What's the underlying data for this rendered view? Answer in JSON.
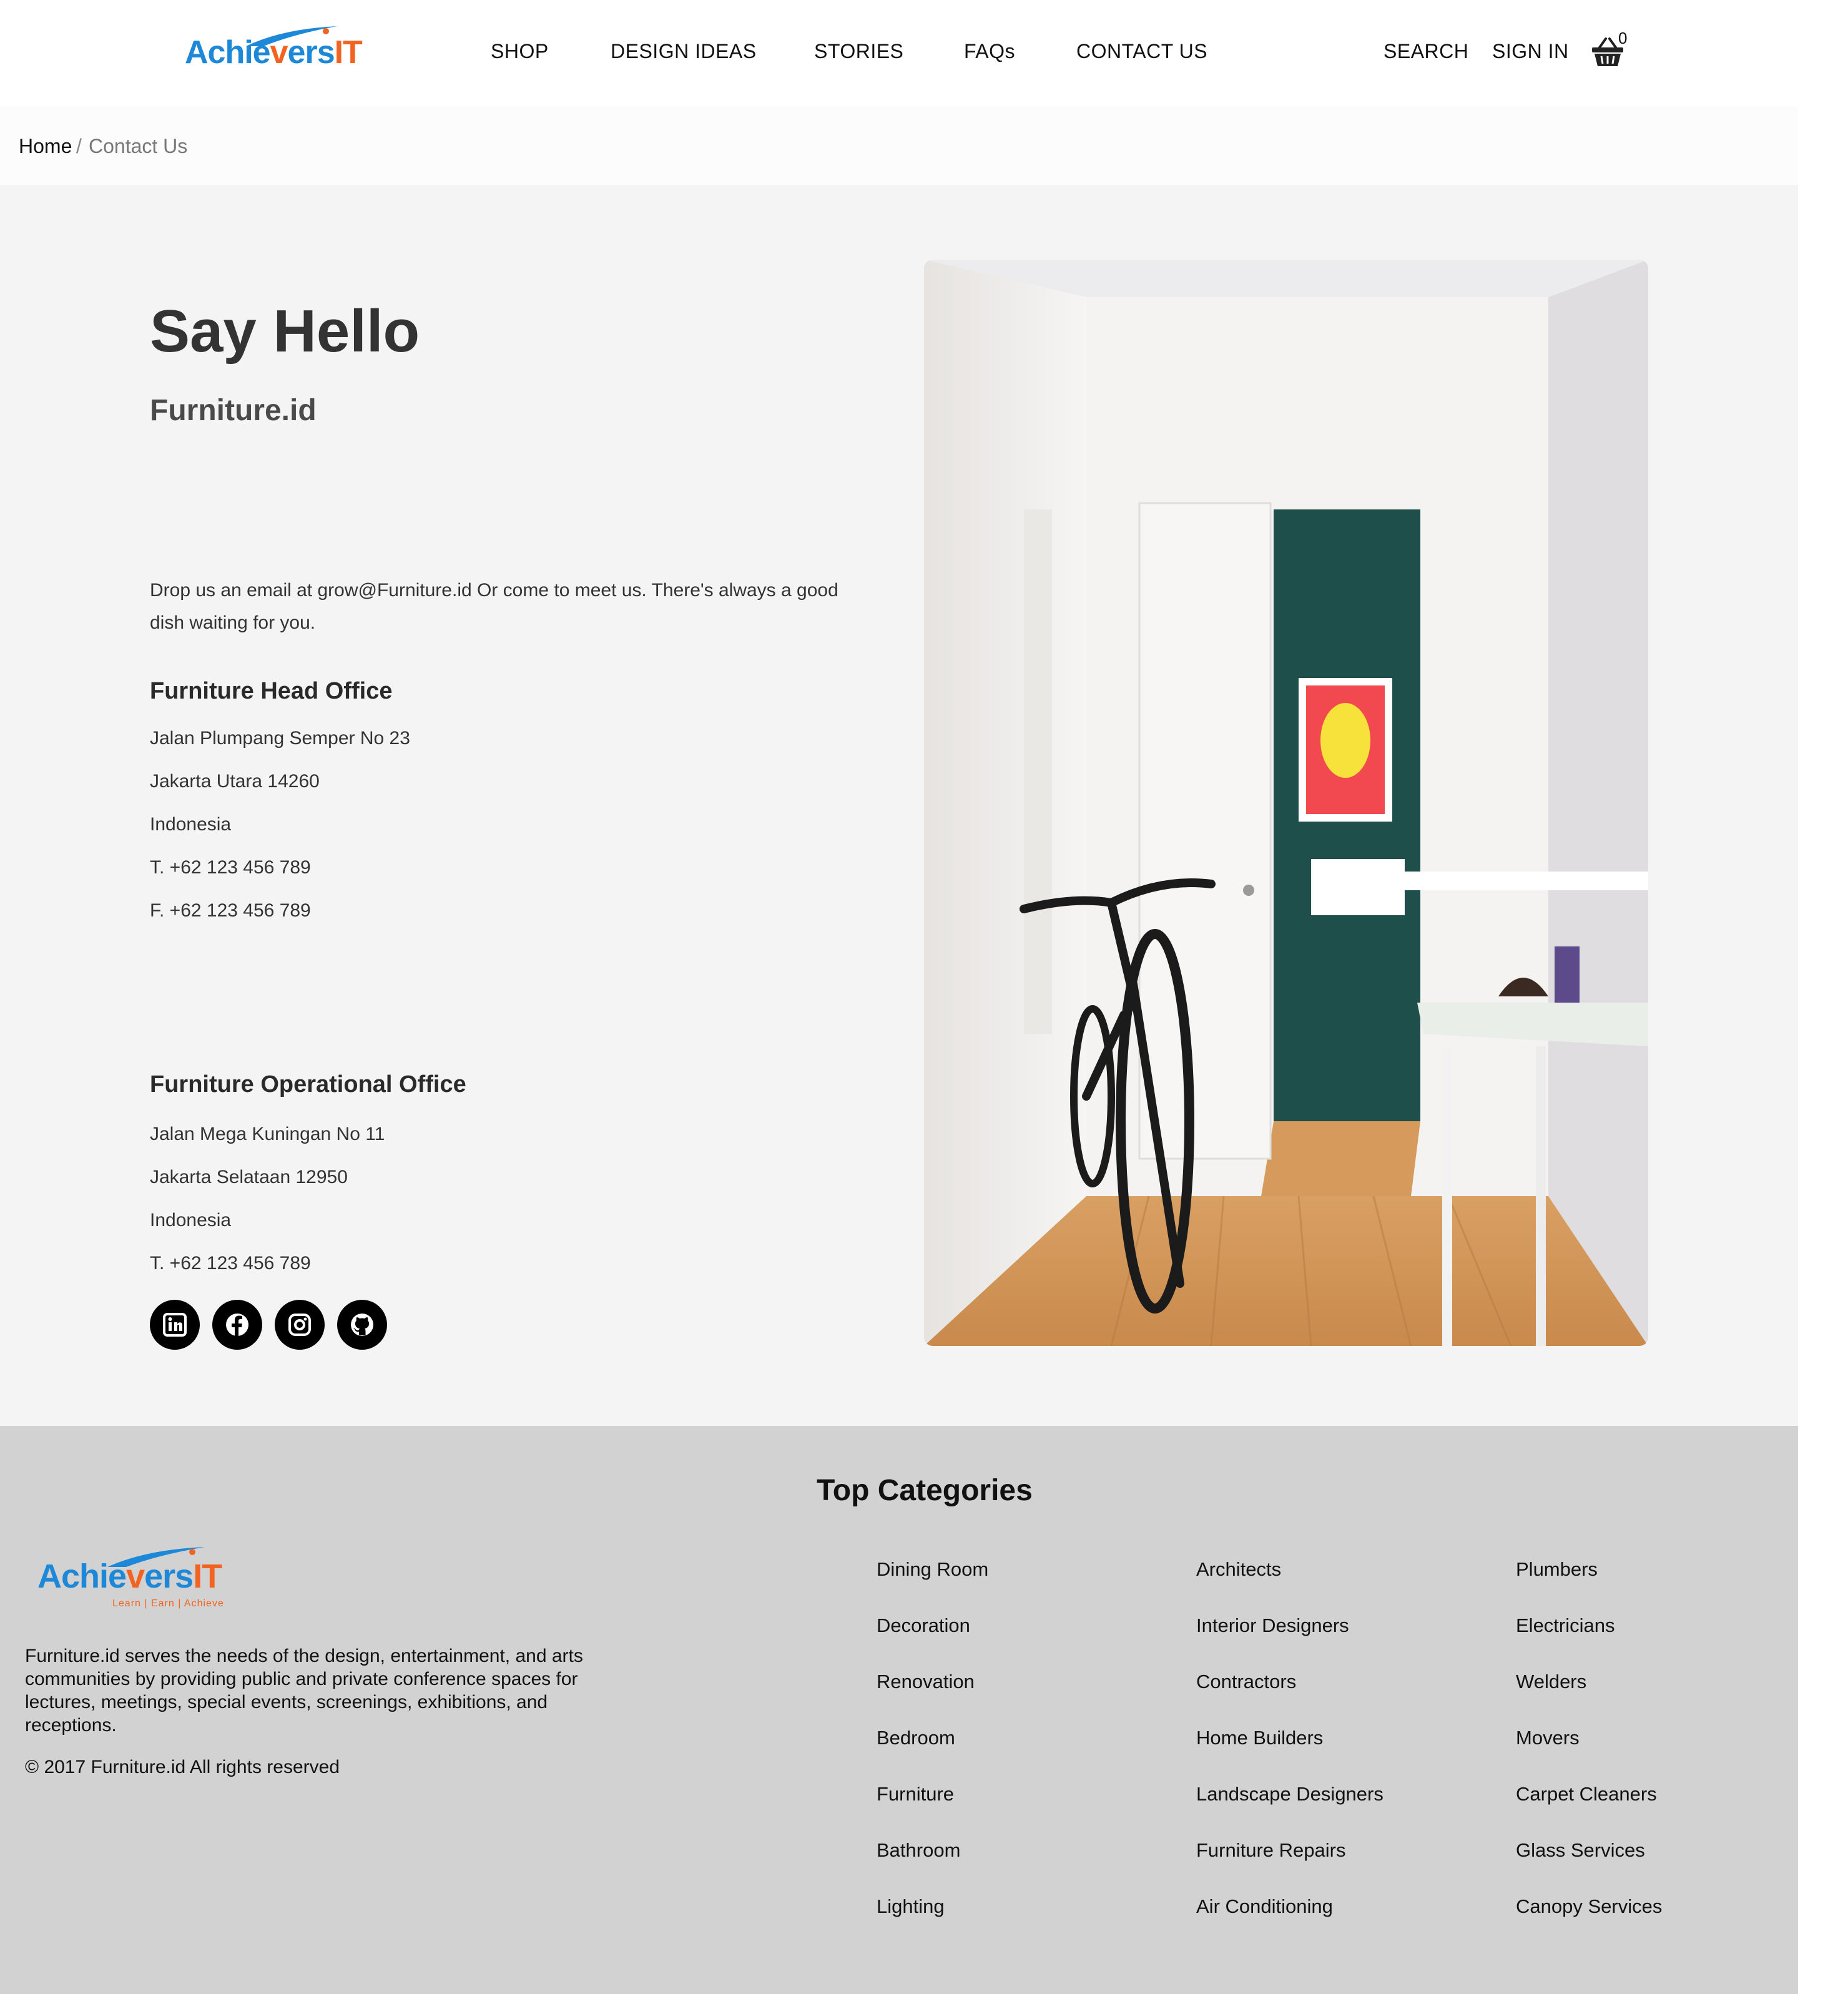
{
  "brand": {
    "logo_part1": "Achie",
    "logo_part2": "ers",
    "logo_part3": "IT",
    "tagline": "Learn | Earn | Achieve"
  },
  "header": {
    "nav": [
      "SHOP",
      "DESIGN IDEAS",
      "STORIES",
      "FAQs",
      "CONTACT US"
    ],
    "search": "SEARCH",
    "sign_in": "SIGN IN",
    "cart_count": "0"
  },
  "breadcrumb": {
    "home": "Home",
    "separator": "/",
    "current": "Contact Us"
  },
  "contact": {
    "title": "Say Hello",
    "subtitle": "Furniture.id",
    "intro": "Drop us an email at grow@Furniture.id Or come to meet us. There's always a good dish waiting for you.",
    "head_office": {
      "title": "Furniture Head Office",
      "lines": [
        "Jalan Plumpang Semper No 23",
        "Jakarta Utara 14260",
        "Indonesia",
        "T. +62 123 456 789",
        "F. +62 123 456 789"
      ]
    },
    "operational_office": {
      "title": "Furniture Operational Office",
      "lines": [
        "Jalan Mega Kuningan No 11",
        "Jakarta Selataan 12950",
        "Indonesia",
        "T. +62 123 456 789"
      ]
    },
    "social_icons": [
      "linkedin-icon",
      "facebook-icon",
      "instagram-icon",
      "github-icon"
    ]
  },
  "footer": {
    "top_categories_title": "Top Categories",
    "about": "Furniture.id serves the needs of the design, entertainment, and arts communities by providing public and private conference spaces for lectures, meetings, special events, screenings, exhibitions, and receptions.",
    "copyright": "© 2017 Furniture.id All rights reserved",
    "categories": [
      [
        "Dining Room",
        "Decoration",
        "Renovation",
        "Bedroom",
        "Furniture",
        "Bathroom",
        "Lighting"
      ],
      [
        "Architects",
        "Interior Designers",
        "Contractors",
        "Home Builders",
        "Landscape Designers",
        "Furniture Repairs",
        "Air Conditioning"
      ],
      [
        "Plumbers",
        "Electricians",
        "Welders",
        "Movers",
        "Carpet Cleaners",
        "Glass Services",
        "Canopy Services"
      ]
    ]
  },
  "colors": {
    "brand_blue": "#1e88d8",
    "brand_orange": "#f26322",
    "main_bg": "#f4f4f4",
    "footer_bg": "#d3d2d2",
    "accent_wall": "#1f4f4a"
  }
}
